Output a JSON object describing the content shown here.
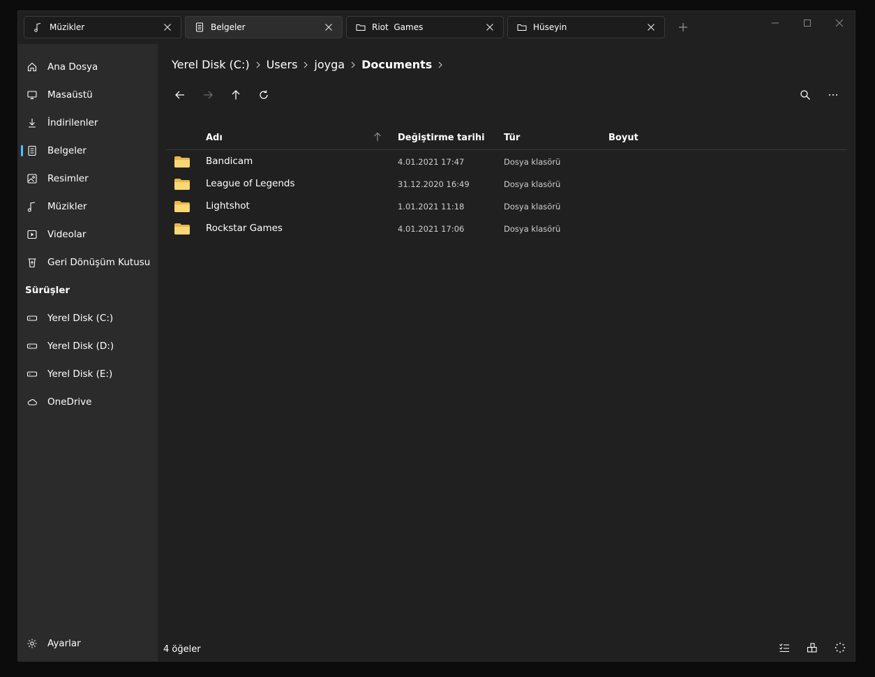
{
  "tabs": [
    {
      "label": "Müzikler",
      "icon": "music-note-icon",
      "active": false
    },
    {
      "label": "Belgeler",
      "icon": "document-icon",
      "active": true
    },
    {
      "label": "Riot  Games",
      "icon": "folder-icon",
      "active": false
    },
    {
      "label": "Hüseyin",
      "icon": "folder-icon",
      "active": false
    }
  ],
  "sidebar": {
    "items": [
      {
        "label": "Ana Dosya",
        "icon": "home-icon"
      },
      {
        "label": "Masaüstü",
        "icon": "desktop-icon"
      },
      {
        "label": "İndirilenler",
        "icon": "download-icon"
      },
      {
        "label": "Belgeler",
        "icon": "document-icon",
        "selected": true
      },
      {
        "label": "Resimler",
        "icon": "picture-icon"
      },
      {
        "label": "Müzikler",
        "icon": "music-note-icon"
      },
      {
        "label": "Videolar",
        "icon": "video-icon"
      },
      {
        "label": "Geri Dönüşüm Kutusu",
        "icon": "recycle-bin-icon"
      }
    ],
    "drives_header": "Sürüşler",
    "drives": [
      {
        "label": "Yerel Disk (C:)",
        "icon": "drive-icon"
      },
      {
        "label": "Yerel Disk (D:)",
        "icon": "drive-icon"
      },
      {
        "label": "Yerel Disk (E:)",
        "icon": "drive-icon"
      },
      {
        "label": "OneDrive",
        "icon": "cloud-icon"
      }
    ],
    "settings_label": "Ayarlar"
  },
  "breadcrumb": [
    "Yerel Disk (C:)",
    "Users",
    "joyga",
    "Documents"
  ],
  "columns": {
    "name": "Adı",
    "modified": "Değiştirme tarihi",
    "type": "Tür",
    "size": "Boyut"
  },
  "files": [
    {
      "name": "Bandicam",
      "modified": "4.01.2021 17:47",
      "type": "Dosya klasörü"
    },
    {
      "name": "League of Legends",
      "modified": "31.12.2020 16:49",
      "type": "Dosya klasörü"
    },
    {
      "name": "Lightshot",
      "modified": "1.01.2021 11:18",
      "type": "Dosya klasörü"
    },
    {
      "name": "Rockstar Games",
      "modified": "4.01.2021 17:06",
      "type": "Dosya klasörü"
    }
  ],
  "status": {
    "item_count": "4 öğeler"
  },
  "colors": {
    "accent": "#4cc2ff",
    "folder": "#f8d775",
    "sidebar_bg": "#2b2b2b",
    "main_bg": "#202020"
  }
}
